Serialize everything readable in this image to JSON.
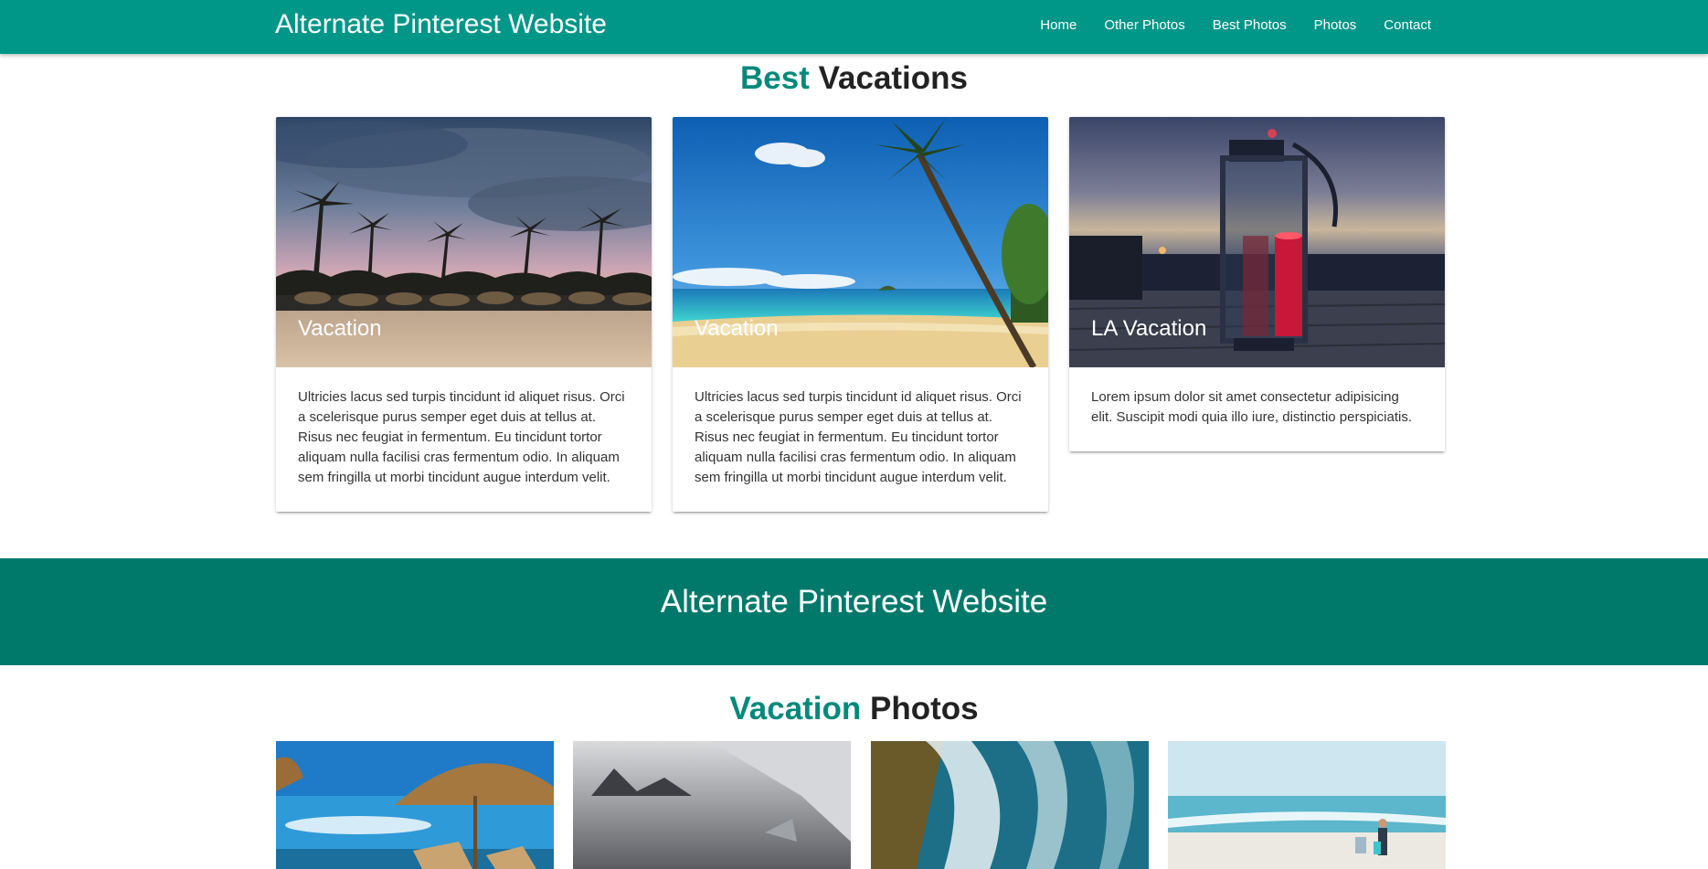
{
  "navbar": {
    "brand": "Alternate Pinterest Website",
    "links": [
      "Home",
      "Other Photos",
      "Best Photos",
      "Photos",
      "Contact"
    ]
  },
  "best_section": {
    "title_accent": "Best",
    "title_rest": "Vacations",
    "cards": [
      {
        "title": "Vacation",
        "text": "Ultricies lacus sed turpis tincidunt id aliquet risus. Orci a scelerisque purus semper eget duis at tellus at. Risus nec feugiat in fermentum. Eu tincidunt tortor aliquam nulla facilisi cras fermentum odio. In aliquam sem fringilla ut morbi tincidunt augue interdum velit."
      },
      {
        "title": "Vacation",
        "text": "Ultricies lacus sed turpis tincidunt id aliquet risus. Orci a scelerisque purus semper eget duis at tellus at. Risus nec feugiat in fermentum. Eu tincidunt tortor aliquam nulla facilisi cras fermentum odio. In aliquam sem fringilla ut morbi tincidunt augue interdum velit."
      },
      {
        "title": "LA Vacation",
        "text": "Lorem ipsum dolor sit amet consectetur adipisicing elit. Suscipit modi quia illo iure, distinctio perspiciatis."
      }
    ]
  },
  "banner": {
    "text": "Alternate Pinterest Website"
  },
  "photos_section": {
    "title_accent": "Vacation",
    "title_rest": "Photos"
  },
  "colors": {
    "primary": "#009688",
    "banner": "#00796b",
    "accent_text": "#00897b"
  }
}
